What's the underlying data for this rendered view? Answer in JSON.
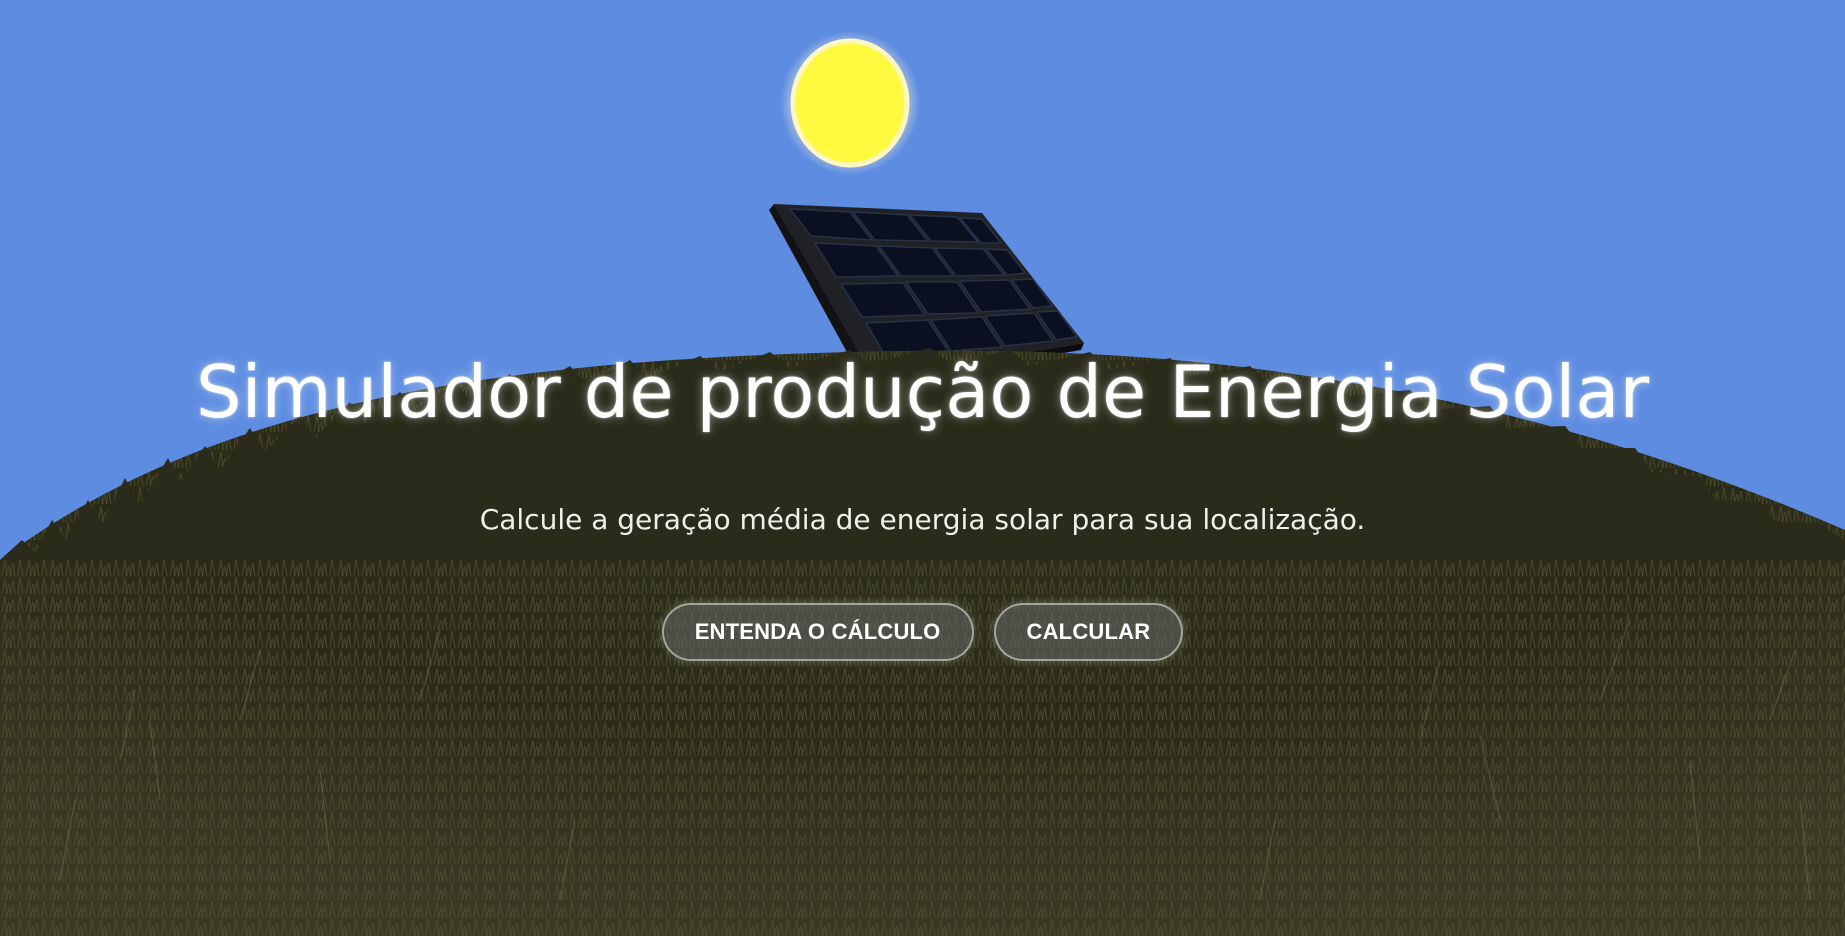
{
  "hero": {
    "title": "Simulador de produção de Energia Solar",
    "subtitle": "Calcule a geração média de energia solar para sua localização."
  },
  "buttons": {
    "understand_label": "ENTENDA O CÁLCULO",
    "calculate_label": "CALCULAR"
  },
  "scene": {
    "sky_color": "#5d8ce1",
    "sun_color": "#ffff55",
    "grass_color": "#2b2b1b",
    "panel_color": "#1b1c26",
    "icons": [
      "sun-icon",
      "solar-panel-icon",
      "grass-hill"
    ]
  }
}
